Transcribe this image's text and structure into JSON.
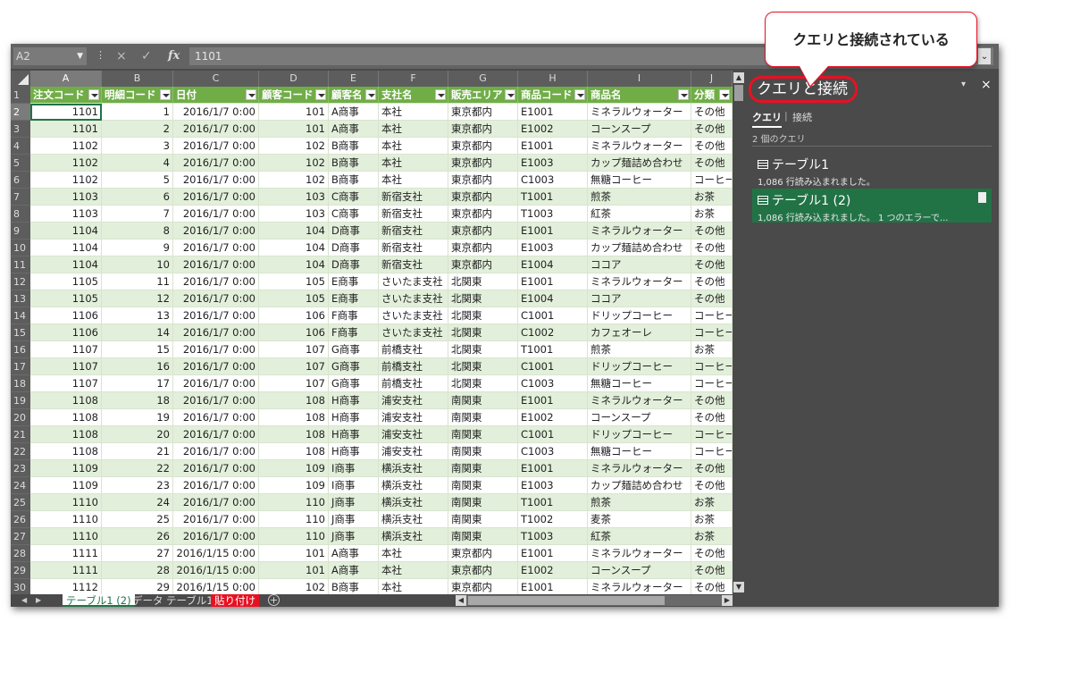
{
  "formula_bar": {
    "name_box": "A2",
    "cancel_icon": "×",
    "enter_icon": "✓",
    "fx_label": "fx",
    "value": "1101"
  },
  "columns": [
    "A",
    "B",
    "C",
    "D",
    "E",
    "F",
    "G",
    "H",
    "I",
    "J"
  ],
  "headers": [
    "注文コード",
    "明細コード",
    "日付",
    "顧客コード",
    "顧客名",
    "支社名",
    "販売エリア",
    "商品コード",
    "商品名",
    "分類"
  ],
  "rows": [
    [
      "1101",
      "1",
      "2016/1/7 0:00",
      "101",
      "A商事",
      "本社",
      "東京都内",
      "E1001",
      "ミネラルウォーター",
      "その他"
    ],
    [
      "1101",
      "2",
      "2016/1/7 0:00",
      "101",
      "A商事",
      "本社",
      "東京都内",
      "E1002",
      "コーンスープ",
      "その他"
    ],
    [
      "1102",
      "3",
      "2016/1/7 0:00",
      "102",
      "B商事",
      "本社",
      "東京都内",
      "E1001",
      "ミネラルウォーター",
      "その他"
    ],
    [
      "1102",
      "4",
      "2016/1/7 0:00",
      "102",
      "B商事",
      "本社",
      "東京都内",
      "E1003",
      "カップ麺詰め合わせ",
      "その他"
    ],
    [
      "1102",
      "5",
      "2016/1/7 0:00",
      "102",
      "B商事",
      "本社",
      "東京都内",
      "C1003",
      "無糖コーヒー",
      "コーヒー"
    ],
    [
      "1103",
      "6",
      "2016/1/7 0:00",
      "103",
      "C商事",
      "新宿支社",
      "東京都内",
      "T1001",
      "煎茶",
      "お茶"
    ],
    [
      "1103",
      "7",
      "2016/1/7 0:00",
      "103",
      "C商事",
      "新宿支社",
      "東京都内",
      "T1003",
      "紅茶",
      "お茶"
    ],
    [
      "1104",
      "8",
      "2016/1/7 0:00",
      "104",
      "D商事",
      "新宿支社",
      "東京都内",
      "E1001",
      "ミネラルウォーター",
      "その他"
    ],
    [
      "1104",
      "9",
      "2016/1/7 0:00",
      "104",
      "D商事",
      "新宿支社",
      "東京都内",
      "E1003",
      "カップ麺詰め合わせ",
      "その他"
    ],
    [
      "1104",
      "10",
      "2016/1/7 0:00",
      "104",
      "D商事",
      "新宿支社",
      "東京都内",
      "E1004",
      "ココア",
      "その他"
    ],
    [
      "1105",
      "11",
      "2016/1/7 0:00",
      "105",
      "E商事",
      "さいたま支社",
      "北関東",
      "E1001",
      "ミネラルウォーター",
      "その他"
    ],
    [
      "1105",
      "12",
      "2016/1/7 0:00",
      "105",
      "E商事",
      "さいたま支社",
      "北関東",
      "E1004",
      "ココア",
      "その他"
    ],
    [
      "1106",
      "13",
      "2016/1/7 0:00",
      "106",
      "F商事",
      "さいたま支社",
      "北関東",
      "C1001",
      "ドリップコーヒー",
      "コーヒー"
    ],
    [
      "1106",
      "14",
      "2016/1/7 0:00",
      "106",
      "F商事",
      "さいたま支社",
      "北関東",
      "C1002",
      "カフェオーレ",
      "コーヒー"
    ],
    [
      "1107",
      "15",
      "2016/1/7 0:00",
      "107",
      "G商事",
      "前橋支社",
      "北関東",
      "T1001",
      "煎茶",
      "お茶"
    ],
    [
      "1107",
      "16",
      "2016/1/7 0:00",
      "107",
      "G商事",
      "前橋支社",
      "北関東",
      "C1001",
      "ドリップコーヒー",
      "コーヒー"
    ],
    [
      "1107",
      "17",
      "2016/1/7 0:00",
      "107",
      "G商事",
      "前橋支社",
      "北関東",
      "C1003",
      "無糖コーヒー",
      "コーヒー"
    ],
    [
      "1108",
      "18",
      "2016/1/7 0:00",
      "108",
      "H商事",
      "浦安支社",
      "南関東",
      "E1001",
      "ミネラルウォーター",
      "その他"
    ],
    [
      "1108",
      "19",
      "2016/1/7 0:00",
      "108",
      "H商事",
      "浦安支社",
      "南関東",
      "E1002",
      "コーンスープ",
      "その他"
    ],
    [
      "1108",
      "20",
      "2016/1/7 0:00",
      "108",
      "H商事",
      "浦安支社",
      "南関東",
      "C1001",
      "ドリップコーヒー",
      "コーヒー"
    ],
    [
      "1108",
      "21",
      "2016/1/7 0:00",
      "108",
      "H商事",
      "浦安支社",
      "南関東",
      "C1003",
      "無糖コーヒー",
      "コーヒー"
    ],
    [
      "1109",
      "22",
      "2016/1/7 0:00",
      "109",
      "I商事",
      "横浜支社",
      "南関東",
      "E1001",
      "ミネラルウォーター",
      "その他"
    ],
    [
      "1109",
      "23",
      "2016/1/7 0:00",
      "109",
      "I商事",
      "横浜支社",
      "南関東",
      "E1003",
      "カップ麺詰め合わせ",
      "その他"
    ],
    [
      "1110",
      "24",
      "2016/1/7 0:00",
      "110",
      "J商事",
      "横浜支社",
      "南関東",
      "T1001",
      "煎茶",
      "お茶"
    ],
    [
      "1110",
      "25",
      "2016/1/7 0:00",
      "110",
      "J商事",
      "横浜支社",
      "南関東",
      "T1002",
      "麦茶",
      "お茶"
    ],
    [
      "1110",
      "26",
      "2016/1/7 0:00",
      "110",
      "J商事",
      "横浜支社",
      "南関東",
      "T1003",
      "紅茶",
      "お茶"
    ],
    [
      "1111",
      "27",
      "2016/1/15 0:00",
      "101",
      "A商事",
      "本社",
      "東京都内",
      "E1001",
      "ミネラルウォーター",
      "その他"
    ],
    [
      "1111",
      "28",
      "2016/1/15 0:00",
      "101",
      "A商事",
      "本社",
      "東京都内",
      "E1002",
      "コーンスープ",
      "その他"
    ],
    [
      "1112",
      "29",
      "2016/1/15 0:00",
      "102",
      "B商事",
      "本社",
      "東京都内",
      "E1001",
      "ミネラルウォーター",
      "その他"
    ]
  ],
  "sheet_tabs": [
    "テーブル1 (2)",
    "データ",
    "テーブル1",
    "貼り付け"
  ],
  "pane": {
    "title": "クエリと接続",
    "minimize_icon": "▾",
    "close_icon": "×",
    "tab_queries": "クエリ",
    "tab_separator": "|",
    "tab_connections": "接続",
    "query_count": "2 個のクエリ",
    "queries": [
      {
        "name": "テーブル1",
        "status": "1,086 行読み込まれました。"
      },
      {
        "name": "テーブル1 (2)",
        "status": "1,086 行読み込まれました。 1 つのエラーで..."
      }
    ]
  },
  "callout": {
    "text": "クエリと接続されている"
  },
  "colors": {
    "header_green": "#70ad47",
    "band_green": "#e2efda",
    "selected_query": "#217346",
    "highlight_red": "#e81123"
  }
}
